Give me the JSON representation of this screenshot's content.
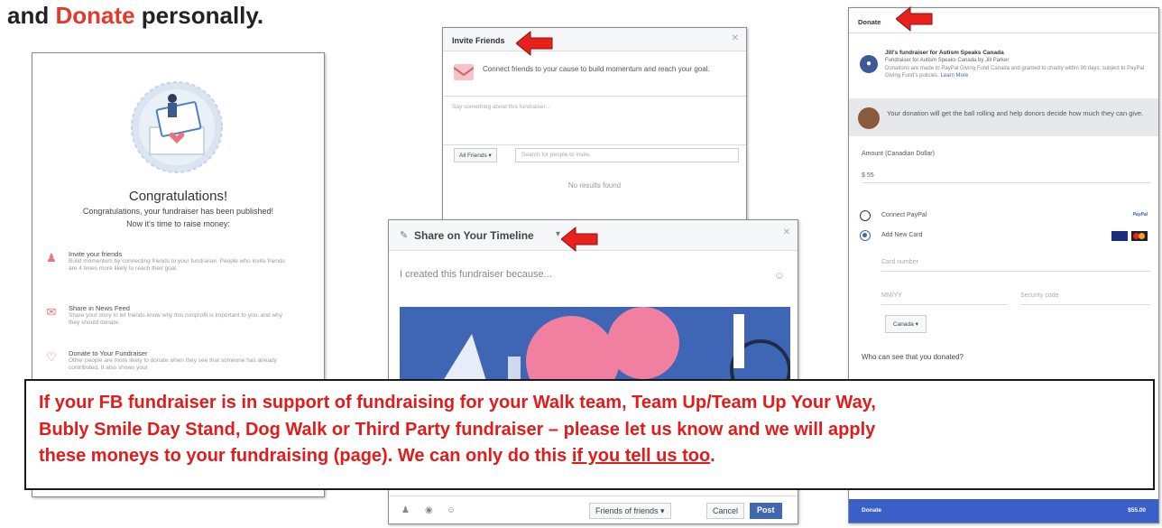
{
  "heading": {
    "prefix": "and ",
    "donate": "Donate",
    "suffix": " personally."
  },
  "congrats": {
    "title": "Congratulations!",
    "line1": "Congratulations, your fundraiser has been published!",
    "line2": "Now it's time to raise money:",
    "items": [
      {
        "title": "Invite your friends",
        "desc": "Build momentum by connecting friends to your fundraiser. People who invite friends are 4 times more likely to reach their goal."
      },
      {
        "title": "Share in News Feed",
        "desc": "Share your story to let friends know why this nonprofit is important to you, and why they should donate."
      },
      {
        "title": "Donate to Your Fundraiser",
        "desc": "Other people are more likely to donate when they see that someone has already contributed. It also shows your"
      }
    ]
  },
  "invite": {
    "title": "Invite Friends",
    "connect_text": "Connect friends to your cause to build momentum and reach your goal.",
    "say_placeholder": "Say something about this fundraiser...",
    "filter_label": "All Friends ▾",
    "search_placeholder": "Search for people to invite",
    "no_results": "No results found"
  },
  "share": {
    "title": "Share on Your Timeline",
    "placeholder": "I created this fundraiser because...",
    "audience": "Friends of friends ▾",
    "cancel": "Cancel",
    "post": "Post"
  },
  "donate": {
    "title": "Donate",
    "fund_title": "Jill's fundraiser for Autism Speaks Canada",
    "fund_sub": "Fundraiser for Autism Speaks Canada by Jill Parker",
    "fund_desc": "Donations are made to PayPal Giving Fund Canada and granted to charity within 90 days, subject to PayPal Giving Fund's policies.",
    "learn_more": "Learn More",
    "banner": "Your donation will get the ball rolling and help donors decide how much they can give.",
    "amount_label": "Amount (Canadian Dollar)",
    "amount_value": "$ 55",
    "opt_paypal": "Connect PayPal",
    "opt_card": "Add New Card",
    "card_number": "Card number",
    "expiry": "MM/YY",
    "security": "Security code",
    "country": "Canada ▾",
    "who_can_see": "Who can see that you donated?",
    "footer_left": "Donate",
    "footer_right": "$55.00"
  },
  "overlay": {
    "line1": "If your FB fundraiser is in support of fundraising for your Walk team, Team Up/Team Up Your Way,",
    "line2": "Bubly Smile Day Stand, Dog Walk or Third Party fundraiser – please let us know and we will apply",
    "line3_a": "these moneys to your fundraising (page).   We can only do this ",
    "line3_u": "if you tell us too",
    "line3_b": "."
  },
  "colors": {
    "red": "#e21b1b",
    "fb_blue": "#4267b2",
    "arrow": "#e8221b"
  }
}
